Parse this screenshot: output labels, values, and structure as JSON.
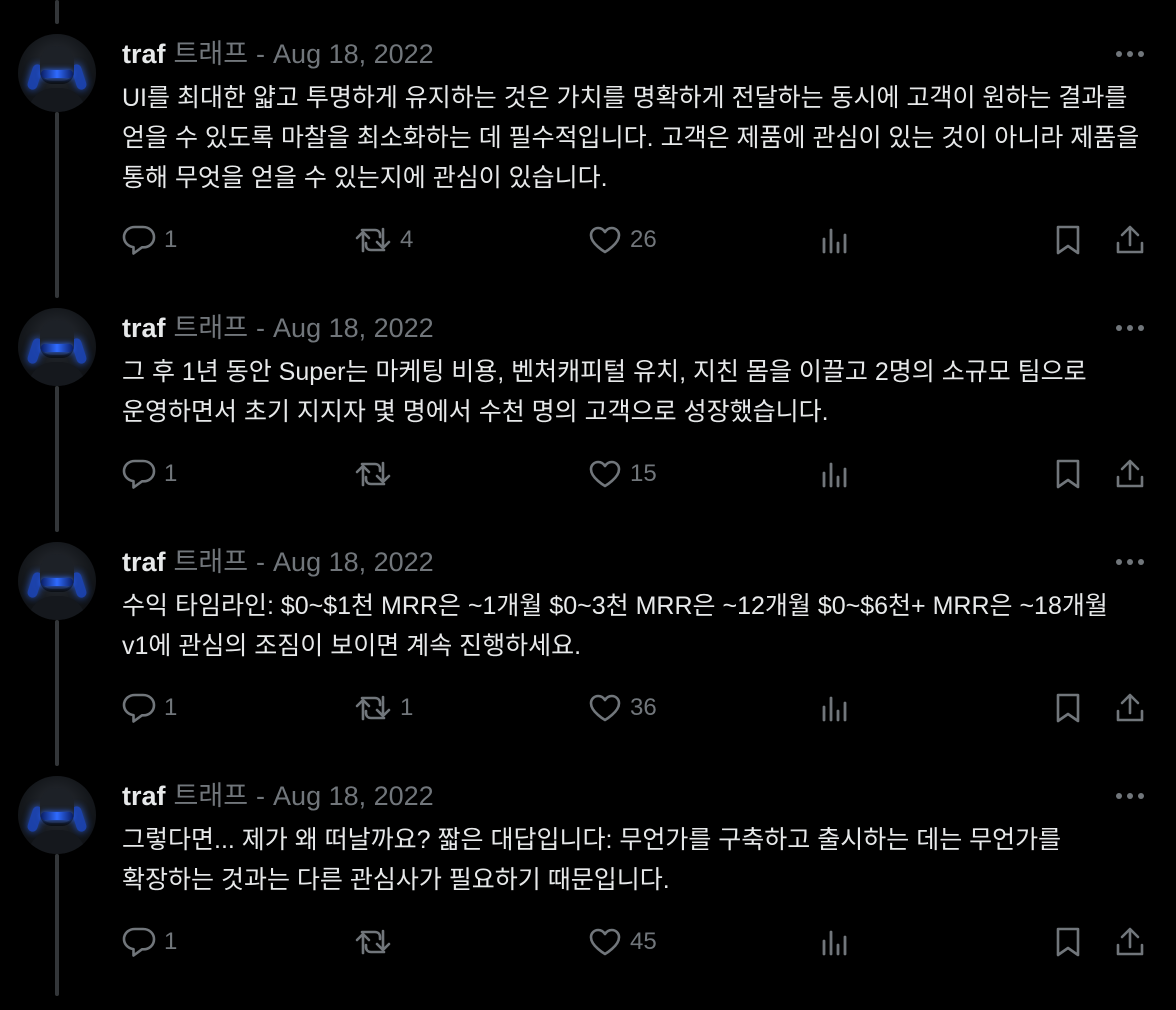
{
  "tweets": [
    {
      "author": "traf",
      "handle": "트래프",
      "separator": "-",
      "date": "Aug 18, 2022",
      "text": "UI를 최대한 얇고 투명하게 유지하는 것은 가치를 명확하게 전달하는 동시에 고객이 원하는 결과를 얻을 수 있도록 마찰을 최소화하는 데 필수적입니다. 고객은 제품에 관심이 있는 것이 아니라 제품을 통해 무엇을 얻을 수 있는지에 관심이 있습니다.",
      "replies": "1",
      "retweets": "4",
      "likes": "26"
    },
    {
      "author": "traf",
      "handle": "트래프",
      "separator": "-",
      "date": "Aug 18, 2022",
      "text": "그 후 1년 동안 Super는 마케팅 비용, 벤처캐피털 유치, 지친 몸을 이끌고 2명의 소규모 팀으로 운영하면서 초기 지지자 몇 명에서 수천 명의 고객으로 성장했습니다.",
      "replies": "1",
      "retweets": "",
      "likes": "15"
    },
    {
      "author": "traf",
      "handle": "트래프",
      "separator": "-",
      "date": "Aug 18, 2022",
      "text": "수익 타임라인: $0~$1천 MRR은 ~1개월 $0~3천 MRR은 ~12개월 $0~$6천+ MRR은 ~18개월 v1에 관심의 조짐이 보이면 계속 진행하세요.",
      "replies": "1",
      "retweets": "1",
      "likes": "36"
    },
    {
      "author": "traf",
      "handle": "트래프",
      "separator": "-",
      "date": "Aug 18, 2022",
      "text": "그렇다면... 제가 왜 떠날까요? 짧은 대답입니다: 무언가를 구축하고 출시하는 데는 무언가를 확장하는 것과는 다른 관심사가 필요하기 때문입니다.",
      "replies": "1",
      "retweets": "",
      "likes": "45"
    }
  ],
  "icons": {
    "reply": "reply-icon",
    "retweet": "retweet-icon",
    "like": "heart-icon",
    "views": "views-icon",
    "bookmark": "bookmark-icon",
    "share": "share-icon",
    "more": "more-icon"
  },
  "colors": {
    "background": "#000000",
    "text": "#e7e9ea",
    "muted": "#71767b",
    "thread_line": "#333639"
  }
}
